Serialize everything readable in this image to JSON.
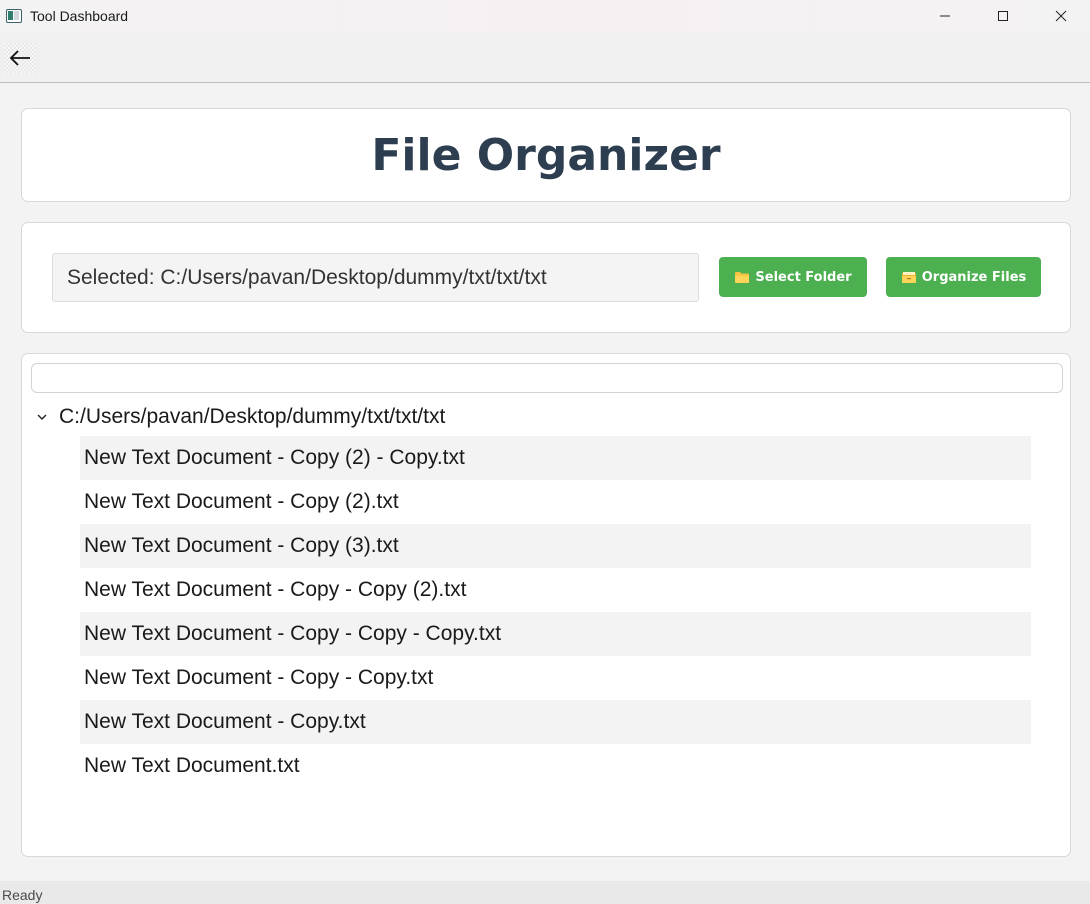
{
  "window": {
    "title": "Tool Dashboard",
    "icon": "app-window-icon",
    "controls": [
      "minimize-icon",
      "maximize-icon",
      "close-icon"
    ]
  },
  "toolbar": {
    "back_icon": "arrow-left-icon"
  },
  "header": {
    "title": "File Organizer"
  },
  "controls": {
    "selected_path": "Selected: C:/Users/pavan/Desktop/dummy/txt/txt/txt",
    "select_folder_icon": "folder-icon",
    "select_folder_label": "Select Folder",
    "organize_icon": "card-index-dividers-icon",
    "organize_label": "Organize Files",
    "button_color": "#4caf50"
  },
  "tree": {
    "filter_value": "",
    "root_label": "C:/Users/pavan/Desktop/dummy/txt/txt/txt",
    "expanded": true,
    "files": [
      "New Text Document - Copy (2) - Copy.txt",
      "New Text Document - Copy (2).txt",
      "New Text Document - Copy (3).txt",
      "New Text Document - Copy - Copy (2).txt",
      "New Text Document - Copy - Copy - Copy.txt",
      "New Text Document - Copy - Copy.txt",
      "New Text Document - Copy.txt",
      "New Text Document.txt"
    ]
  },
  "status": {
    "text": "Ready"
  }
}
